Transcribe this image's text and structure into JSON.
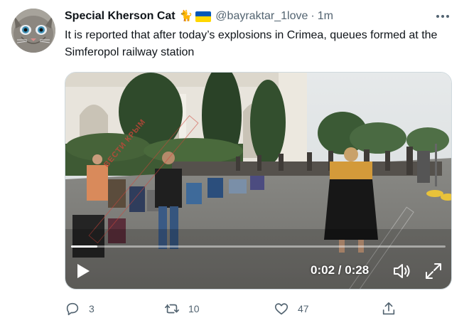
{
  "tweet": {
    "author": {
      "display_name": "Special Kherson Cat",
      "emoji_icons": [
        "cat-emoji",
        "ukraine-flag-icon"
      ],
      "handle": "@bayraktar_1love",
      "separator": "·",
      "time": "1m"
    },
    "text": "It is reported that after today’s explosions in Crimea, queues formed at the Simferopol railway station",
    "video": {
      "watermark": "ВЕСТИ КРЫМ",
      "time_display": "0:02 / 0:28",
      "progress": 0.071,
      "controls": {
        "play_icon": "play-icon",
        "volume_icon": "volume-icon",
        "fullscreen_icon": "fullscreen-icon"
      }
    },
    "actions": {
      "reply_count": "3",
      "retweet_count": "10",
      "like_count": "47"
    }
  },
  "colors": {
    "text_primary": "#0f1419",
    "text_secondary": "#536471",
    "border": "#cfd9de"
  }
}
